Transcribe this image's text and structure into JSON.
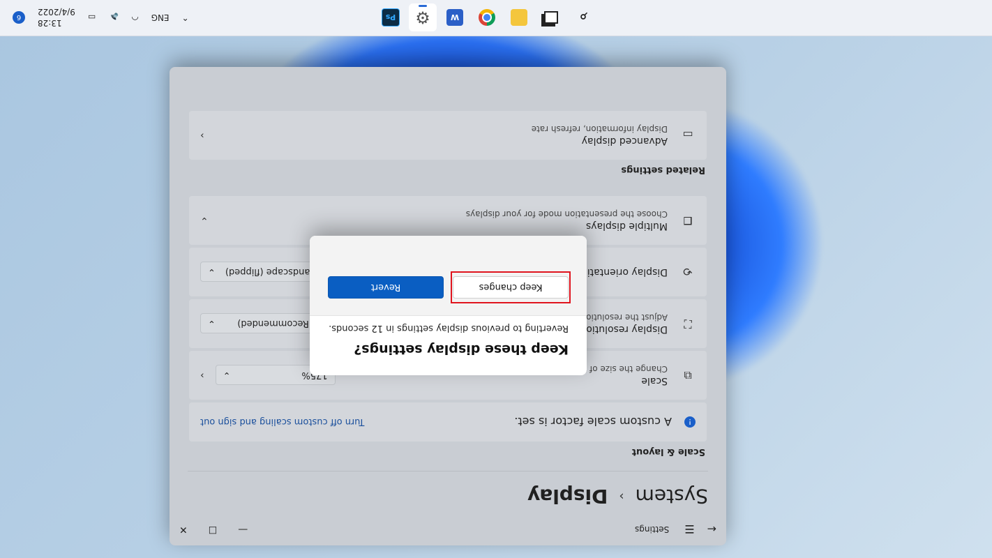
{
  "taskbar": {
    "apps": [
      {
        "name": "windows-start",
        "label": ""
      },
      {
        "name": "search",
        "label": ""
      },
      {
        "name": "task-view",
        "label": ""
      },
      {
        "name": "file-explorer",
        "label": ""
      },
      {
        "name": "chrome",
        "label": ""
      },
      {
        "name": "word",
        "label": "W"
      },
      {
        "name": "settings",
        "label": ""
      },
      {
        "name": "photoshop",
        "label": "Ps"
      }
    ],
    "language": "ENG",
    "time": "13:28",
    "date": "9/4/2022",
    "notification_count": "6"
  },
  "window": {
    "app_title": "Settings",
    "breadcrumb_parent": "System",
    "breadcrumb_separator": "›",
    "breadcrumb_page": "Display",
    "controls": {
      "minimize": "—",
      "maximize": "☐",
      "close": "✕"
    }
  },
  "scale_layout": {
    "section_title": "Scale & layout",
    "info_text": "A custom scale factor is set.",
    "info_link": "Turn off custom scaling and sign out",
    "scale_title": "Scale",
    "scale_subtitle": "Change the size of text, apps, and other items",
    "scale_value": "175%",
    "resolution_title": "Display resolution",
    "resolution_subtitle": "Adjust the resolution to fit your connected display",
    "resolution_value": "(Recommended)",
    "orientation_title": "Display orientation",
    "orientation_value": "Landscape (flipped)",
    "multi_title": "Multiple displays",
    "multi_subtitle": "Choose the presentation mode for your displays"
  },
  "related": {
    "section_title": "Related settings",
    "advanced_title": "Advanced display",
    "advanced_subtitle": "Display information, refresh rate"
  },
  "dialog": {
    "title": "Keep these display settings?",
    "message": "Reverting to previous display settings in 12 seconds.",
    "keep_label": "Keep changes",
    "revert_label": "Revert"
  },
  "colors": {
    "accent": "#0a5ec2",
    "highlight_box": "#e0141e"
  }
}
